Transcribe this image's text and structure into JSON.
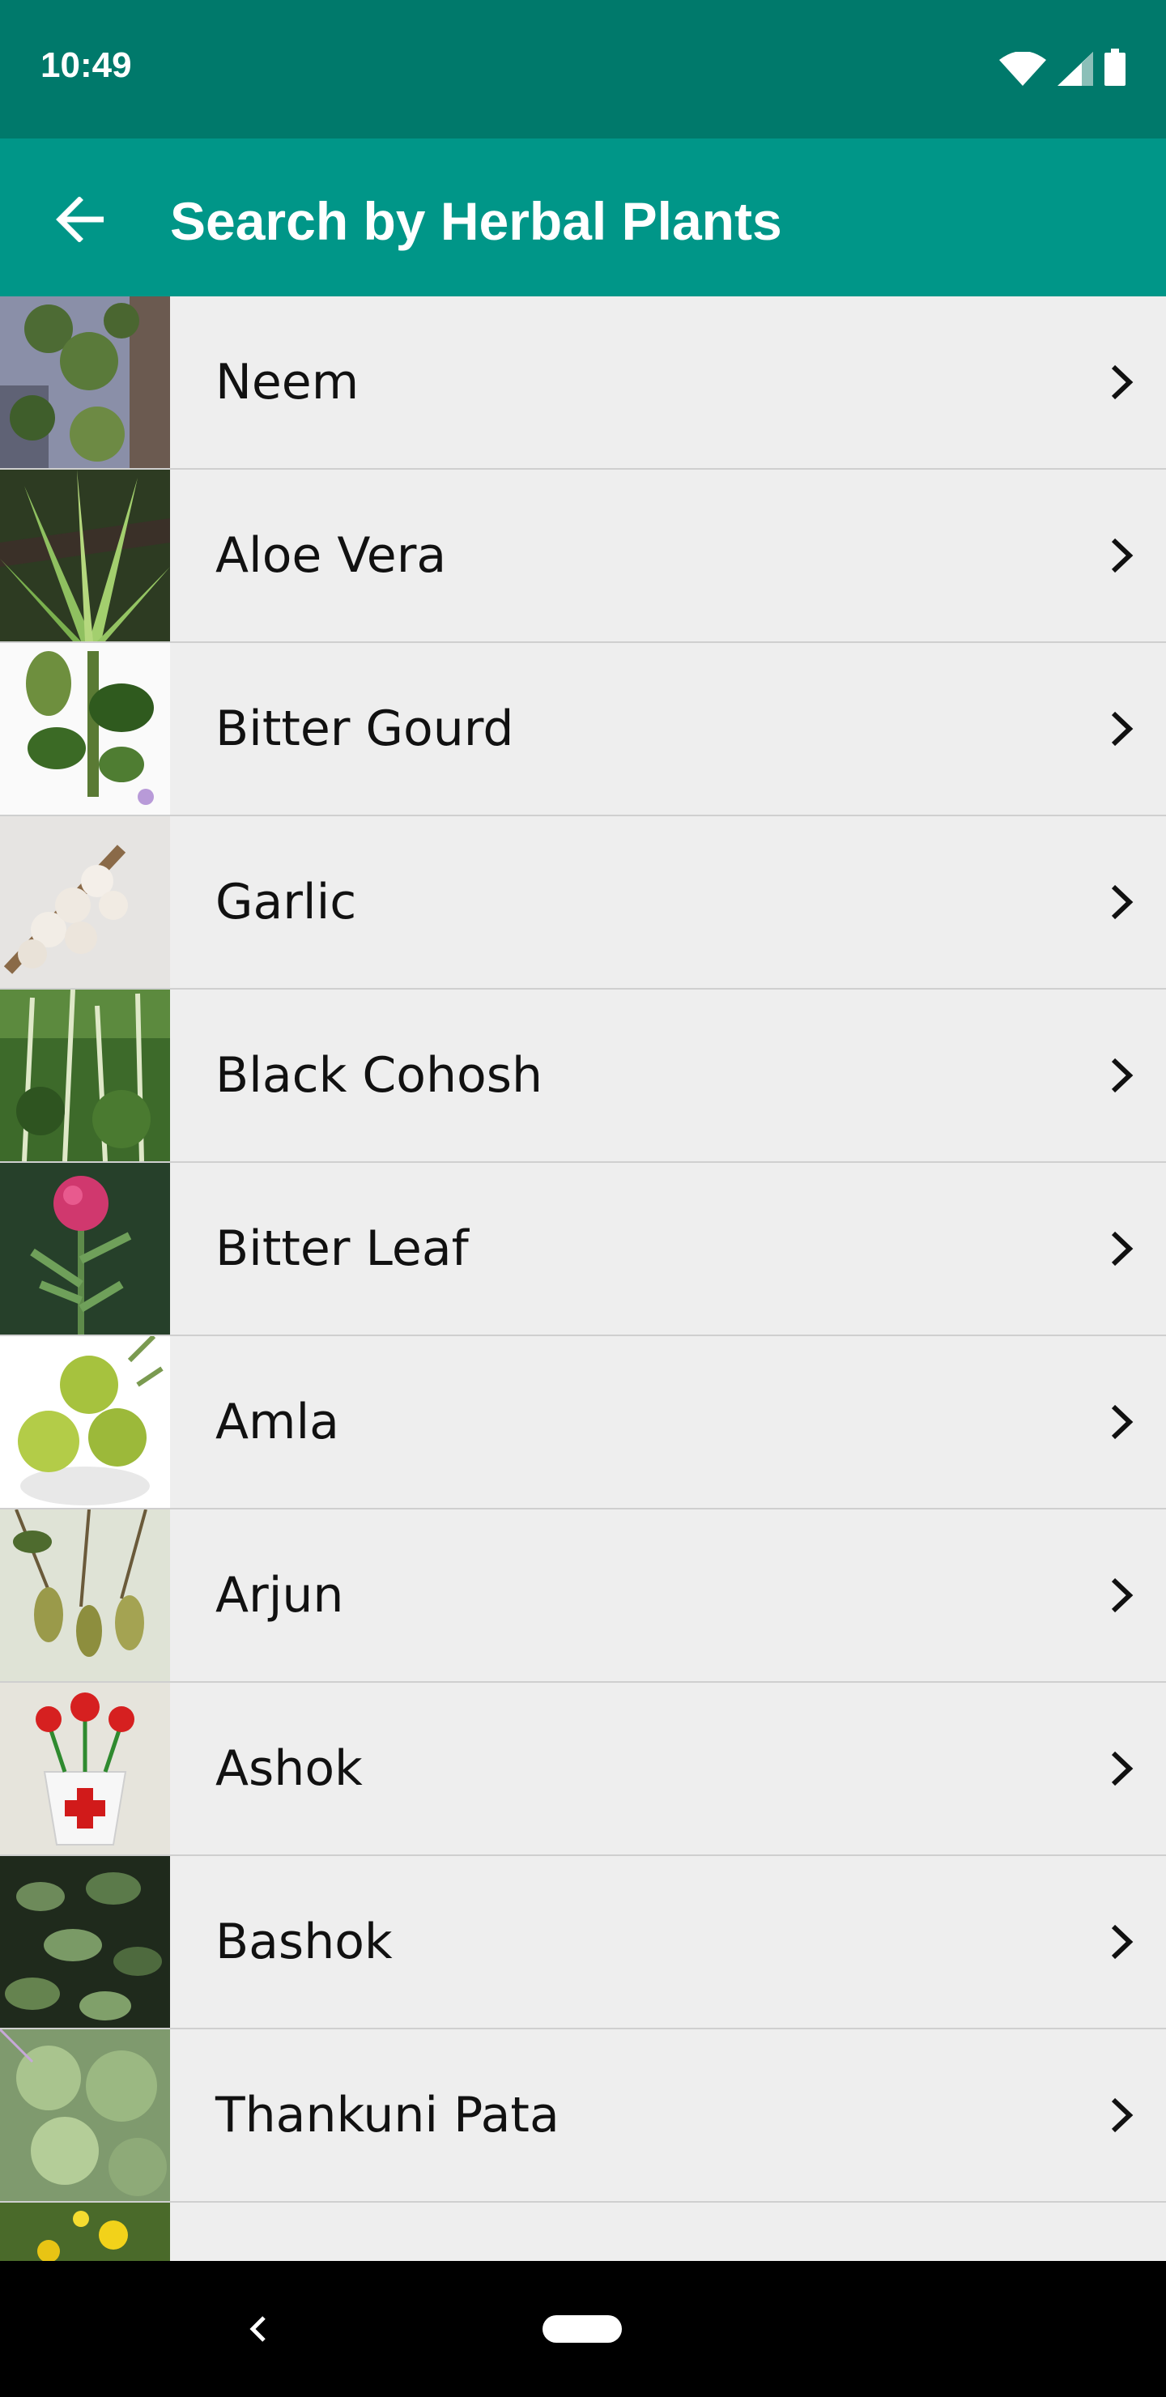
{
  "status_bar": {
    "time": "10:49",
    "icons": [
      "wifi-icon",
      "cellular-signal-icon",
      "battery-icon"
    ]
  },
  "app_bar": {
    "title": "Search by Herbal Plants",
    "back_icon": "arrow-back-icon",
    "color": "#009688"
  },
  "plants": [
    {
      "name": "Neem",
      "thumb": "neem-photo"
    },
    {
      "name": "Aloe Vera",
      "thumb": "aloe-vera-photo"
    },
    {
      "name": "Bitter Gourd",
      "thumb": "bitter-gourd-illustration"
    },
    {
      "name": "Garlic",
      "thumb": "garlic-photo"
    },
    {
      "name": "Black Cohosh",
      "thumb": "black-cohosh-photo"
    },
    {
      "name": "Bitter Leaf",
      "thumb": "bitter-leaf-photo"
    },
    {
      "name": "Amla",
      "thumb": "amla-photo"
    },
    {
      "name": "Arjun",
      "thumb": "arjun-photo"
    },
    {
      "name": "Ashok",
      "thumb": "ashok-flower-pot-image"
    },
    {
      "name": "Bashok",
      "thumb": "bashok-photo"
    },
    {
      "name": "Thankuni Pata",
      "thumb": "thankuni-pata-photo"
    },
    {
      "name": "",
      "thumb": "partial-yellow-flower-photo"
    }
  ],
  "nav_bar": {
    "back_icon": "nav-back-icon",
    "home_icon": "nav-home-pill-icon"
  },
  "colors": {
    "status_bar": "#00796b",
    "app_bar": "#009688",
    "list_bg": "#eeeeee",
    "divider": "#cfcfcf"
  }
}
